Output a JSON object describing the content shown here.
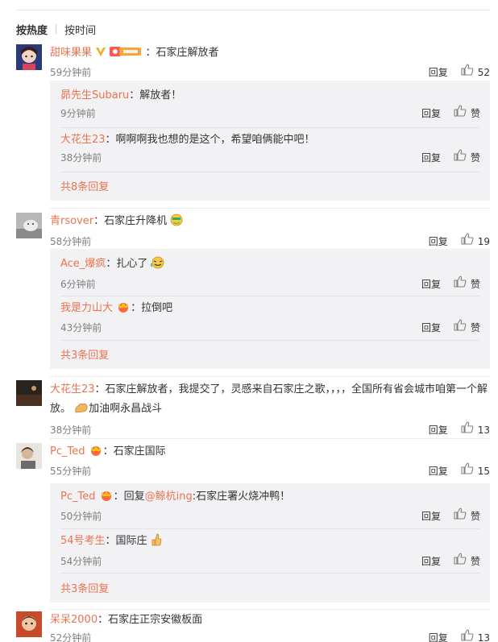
{
  "sort": {
    "hot": "按热度",
    "time": "按时间"
  },
  "ui": {
    "reply": "回复",
    "like": "赞"
  },
  "comments": [
    {
      "user": "甜味果果",
      "text": "：石家庄解放者",
      "time": "59分钟前",
      "likes": "52",
      "replies": [
        {
          "user": "昴先生Subaru",
          "text": "：解放者！",
          "time": "9分钟前"
        },
        {
          "user": "大花生23",
          "text": "：啊啊啊我也想的是这个，希望咱俩能中吧！",
          "time": "38分钟前"
        }
      ],
      "more": "共8条回复"
    },
    {
      "user": "青rsover",
      "text": "：石家庄升降机",
      "time": "58分钟前",
      "likes": "19",
      "replies": [
        {
          "user": "Ace_爆疯",
          "text": "：扎心了",
          "time": "6分钟前"
        },
        {
          "user": "我是力山大",
          "text": "：拉倒吧",
          "time": "43分钟前"
        }
      ],
      "more": "共3条回复"
    },
    {
      "user": "大花生23",
      "text": "：石家庄解放者，我提交了，灵感来自石家庄之歌，，，，全国所有省会城市咱第一个解",
      "text2": "放。",
      "text3": "加油啊永昌战斗",
      "time": "38分钟前",
      "likes": "13"
    },
    {
      "user": "Pc_Ted",
      "text": "：石家庄国际",
      "time": "55分钟前",
      "likes": "15",
      "replies": [
        {
          "user": "Pc_Ted",
          "text_a": "：回复",
          "mention": "@鲸杭ing",
          "text_b": ":石家庄署火烧冲鸭！",
          "time": "50分钟前"
        },
        {
          "user": "54号考生",
          "text": "：国际庄",
          "time": "54分钟前"
        }
      ],
      "more": "共3条回复"
    },
    {
      "user": "呆呆2000",
      "text": "：石家庄正宗安徽板面",
      "time": "52分钟前",
      "likes": "13"
    }
  ],
  "colors": {
    "username": "#eb7350",
    "subbg": "#f2f2f5",
    "time": "#808080"
  },
  "icons": [
    "thumb-up-icon",
    "vip-v-icon",
    "fan-badge-icon",
    "crown-badge-icon",
    "emoji-icon",
    "flex-arm-icon",
    "thumbs-up-emoji-icon"
  ]
}
